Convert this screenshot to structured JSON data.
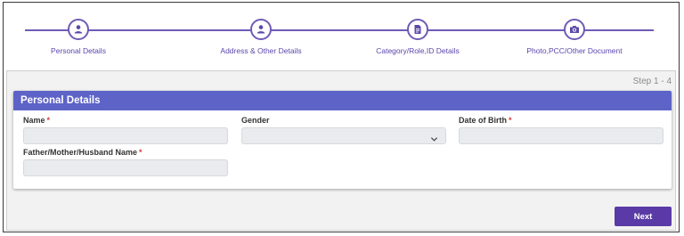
{
  "stepper": {
    "steps": [
      {
        "label": "Personal Details",
        "icon": "user-icon"
      },
      {
        "label": "Address & Other Details",
        "icon": "user-icon"
      },
      {
        "label": "Category/Role,ID Details",
        "icon": "document-icon"
      },
      {
        "label": "Photo,PCC/Other Document",
        "icon": "camera-icon"
      }
    ]
  },
  "step_count": "Step 1 - 4",
  "card": {
    "title": "Personal Details"
  },
  "fields": {
    "name": {
      "label": "Name",
      "required_mark": "*",
      "value": ""
    },
    "gender": {
      "label": "Gender",
      "value": ""
    },
    "dob": {
      "label": "Date of Birth",
      "required_mark": "*",
      "value": ""
    },
    "guardian": {
      "label": "Father/Mother/Husband Name",
      "required_mark": "*",
      "value": ""
    }
  },
  "next_label": "Next",
  "colors": {
    "accent": "#5a3aa6",
    "header": "#5e63c8",
    "stepper": "#6f5bb5",
    "required": "#d83a3a"
  }
}
